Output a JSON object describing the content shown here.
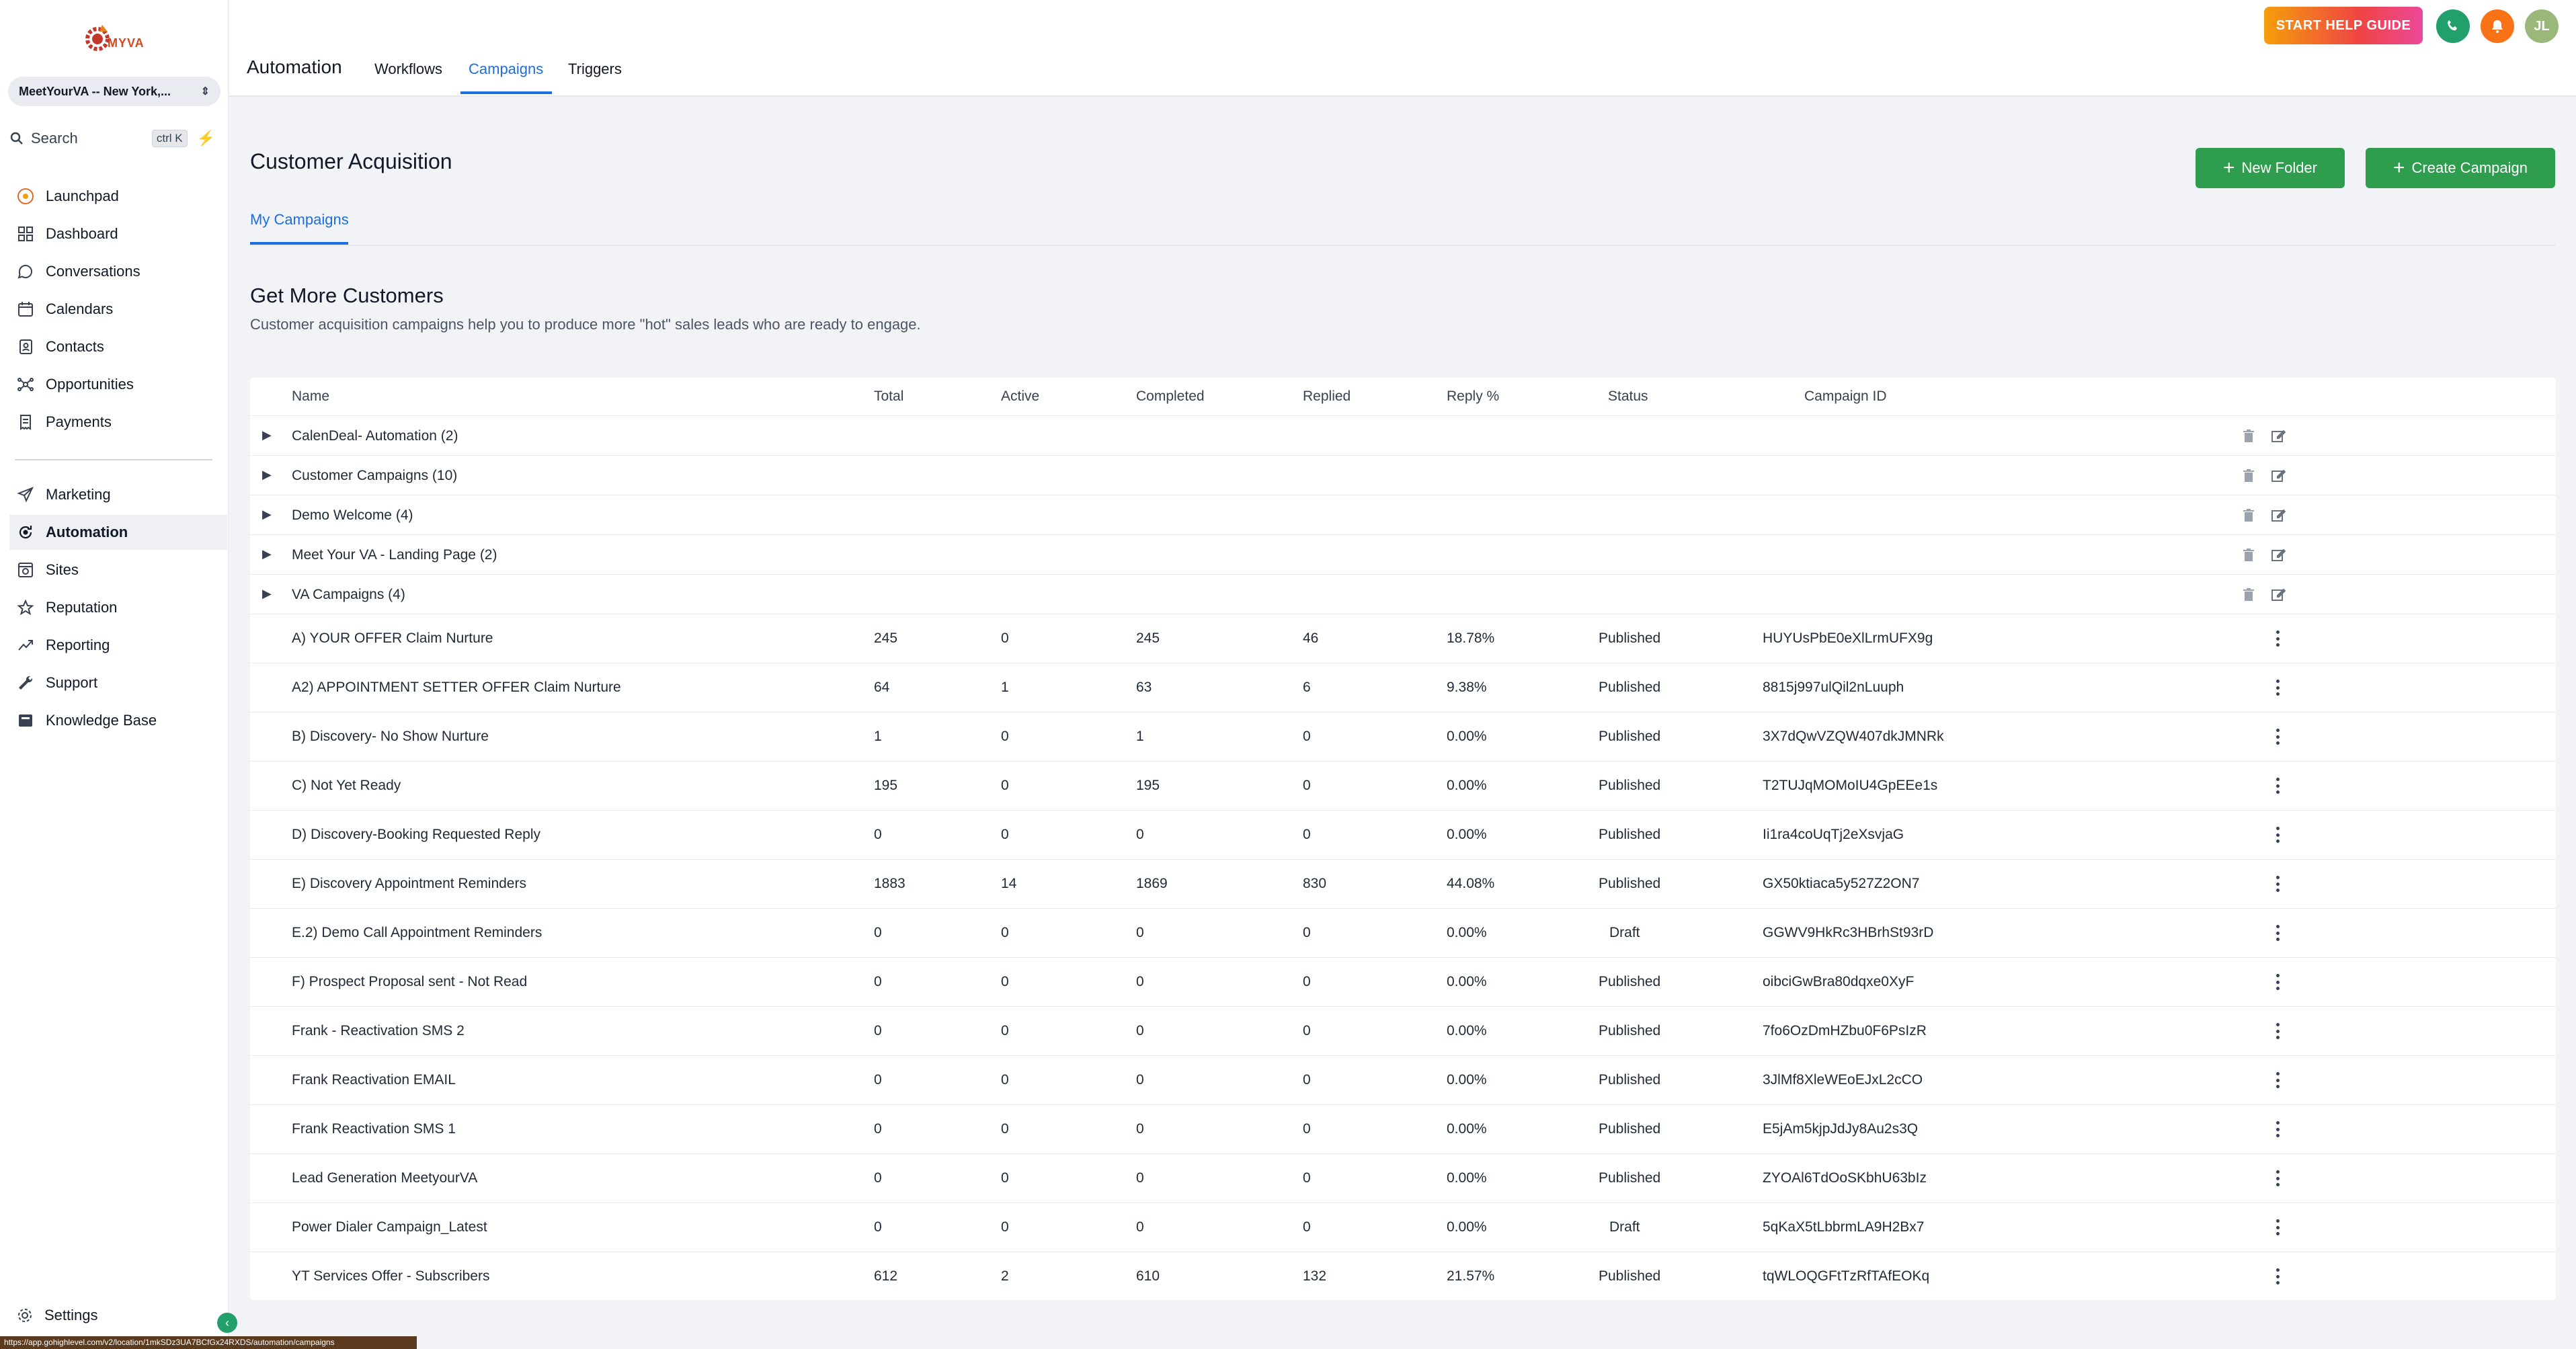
{
  "sidebar": {
    "logo_text": "MYVA",
    "location": "MeetYourVA -- New York,...",
    "search_label": "Search",
    "search_shortcut": "ctrl K",
    "items": [
      {
        "label": "Launchpad",
        "icon": "rocket-icon"
      },
      {
        "label": "Dashboard",
        "icon": "grid-icon"
      },
      {
        "label": "Conversations",
        "icon": "chat-icon"
      },
      {
        "label": "Calendars",
        "icon": "calendar-icon"
      },
      {
        "label": "Contacts",
        "icon": "contacts-icon"
      },
      {
        "label": "Opportunities",
        "icon": "network-icon"
      },
      {
        "label": "Payments",
        "icon": "receipt-icon"
      },
      {
        "label": "Marketing",
        "icon": "send-icon"
      },
      {
        "label": "Automation",
        "icon": "automation-icon"
      },
      {
        "label": "Sites",
        "icon": "sites-icon"
      },
      {
        "label": "Reputation",
        "icon": "star-icon"
      },
      {
        "label": "Reporting",
        "icon": "trend-icon"
      },
      {
        "label": "Support",
        "icon": "wrench-icon"
      },
      {
        "label": "Knowledge Base",
        "icon": "book-icon"
      }
    ],
    "settings_label": "Settings",
    "status_url": "https://app.gohighlevel.com/v2/location/1mkSDz3UA7BCfGx24RXDS/automation/campaigns"
  },
  "topbar": {
    "title": "Automation",
    "tabs": [
      "Workflows",
      "Campaigns",
      "Triggers"
    ],
    "active_tab": "Campaigns",
    "help_button": "START HELP GUIDE",
    "avatar_initials": "JL"
  },
  "page": {
    "title": "Customer Acquisition",
    "new_folder_label": "New Folder",
    "create_campaign_label": "Create Campaign",
    "subtab": "My Campaigns",
    "section_title": "Get More Customers",
    "section_desc": "Customer acquisition campaigns help you to produce more \"hot\" sales leads who are ready to engage."
  },
  "table": {
    "headers": [
      "Name",
      "Total",
      "Active",
      "Completed",
      "Replied",
      "Reply %",
      "Status",
      "Campaign ID"
    ],
    "folders": [
      "CalenDeal- Automation (2)",
      "Customer Campaigns (10)",
      "Demo Welcome (4)",
      "Meet Your VA - Landing Page (2)",
      "VA Campaigns (4)"
    ],
    "rows": [
      {
        "name": "A) YOUR OFFER Claim Nurture",
        "total": "245",
        "active": "0",
        "completed": "245",
        "replied": "46",
        "reply_pct": "18.78%",
        "status": "Published",
        "id": "HUYUsPbE0eXlLrmUFX9g"
      },
      {
        "name": "A2) APPOINTMENT SETTER OFFER Claim Nurture",
        "total": "64",
        "active": "1",
        "completed": "63",
        "replied": "6",
        "reply_pct": "9.38%",
        "status": "Published",
        "id": "8815j997ulQil2nLuuph"
      },
      {
        "name": "B) Discovery- No Show Nurture",
        "total": "1",
        "active": "0",
        "completed": "1",
        "replied": "0",
        "reply_pct": "0.00%",
        "status": "Published",
        "id": "3X7dQwVZQW407dkJMNRk"
      },
      {
        "name": "C) Not Yet Ready",
        "total": "195",
        "active": "0",
        "completed": "195",
        "replied": "0",
        "reply_pct": "0.00%",
        "status": "Published",
        "id": "T2TUJqMOMoIU4GpEEe1s"
      },
      {
        "name": "D) Discovery-Booking Requested Reply",
        "total": "0",
        "active": "0",
        "completed": "0",
        "replied": "0",
        "reply_pct": "0.00%",
        "status": "Published",
        "id": "Ii1ra4coUqTj2eXsvjaG"
      },
      {
        "name": "E) Discovery Appointment Reminders",
        "total": "1883",
        "active": "14",
        "completed": "1869",
        "replied": "830",
        "reply_pct": "44.08%",
        "status": "Published",
        "id": "GX50ktiaca5y527Z2ON7"
      },
      {
        "name": "E.2) Demo Call Appointment Reminders",
        "total": "0",
        "active": "0",
        "completed": "0",
        "replied": "0",
        "reply_pct": "0.00%",
        "status": "Draft",
        "id": "GGWV9HkRc3HBrhSt93rD"
      },
      {
        "name": "F) Prospect Proposal sent - Not Read",
        "total": "0",
        "active": "0",
        "completed": "0",
        "replied": "0",
        "reply_pct": "0.00%",
        "status": "Published",
        "id": "oibciGwBra80dqxe0XyF"
      },
      {
        "name": "Frank - Reactivation SMS 2",
        "total": "0",
        "active": "0",
        "completed": "0",
        "replied": "0",
        "reply_pct": "0.00%",
        "status": "Published",
        "id": "7fo6OzDmHZbu0F6PsIzR"
      },
      {
        "name": "Frank Reactivation EMAIL",
        "total": "0",
        "active": "0",
        "completed": "0",
        "replied": "0",
        "reply_pct": "0.00%",
        "status": "Published",
        "id": "3JlMf8XleWEoEJxL2cCO"
      },
      {
        "name": "Frank Reactivation SMS 1",
        "total": "0",
        "active": "0",
        "completed": "0",
        "replied": "0",
        "reply_pct": "0.00%",
        "status": "Published",
        "id": "E5jAm5kjpJdJy8Au2s3Q"
      },
      {
        "name": "Lead Generation MeetyourVA",
        "total": "0",
        "active": "0",
        "completed": "0",
        "replied": "0",
        "reply_pct": "0.00%",
        "status": "Published",
        "id": "ZYOAl6TdOoSKbhU63bIz"
      },
      {
        "name": "Power Dialer Campaign_Latest",
        "total": "0",
        "active": "0",
        "completed": "0",
        "replied": "0",
        "reply_pct": "0.00%",
        "status": "Draft",
        "id": "5qKaX5tLbbrmLA9H2Bx7"
      },
      {
        "name": "YT Services Offer - Subscribers",
        "total": "612",
        "active": "2",
        "completed": "610",
        "replied": "132",
        "reply_pct": "21.57%",
        "status": "Published",
        "id": "tqWLOQGFtTzRfTAfEOKq"
      }
    ]
  },
  "colors": {
    "accent": "#1d6fe0",
    "primary_button": "#2e9d4d",
    "phone_button": "#22a06b",
    "bell_button": "#f97316",
    "avatar": "#9ab87a"
  }
}
